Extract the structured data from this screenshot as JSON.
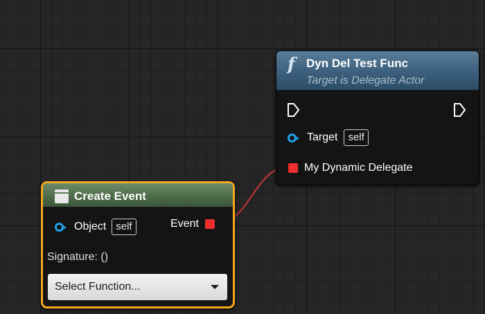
{
  "func_node": {
    "icon": "f",
    "title": "Dyn Del Test Func",
    "subtitle": "Target is Delegate Actor",
    "target_label": "Target",
    "target_default": "self",
    "delegate_label": "My Dynamic Delegate"
  },
  "create_event_node": {
    "title": "Create Event",
    "object_label": "Object",
    "object_default": "self",
    "event_label": "Event",
    "signature_label": "Signature: ()",
    "select_function": "Select Function..."
  },
  "colors": {
    "object_pin": "#21a0e8",
    "delegate_pin": "#ef2e2e",
    "selection_outline": "#f4a81d",
    "wire": "#c8353a"
  },
  "icons": [
    "function-icon",
    "event-icon",
    "exec-in-pin-icon",
    "exec-out-pin-icon",
    "object-pin-icon",
    "delegate-pin-icon",
    "dropdown-arrow-icon"
  ]
}
